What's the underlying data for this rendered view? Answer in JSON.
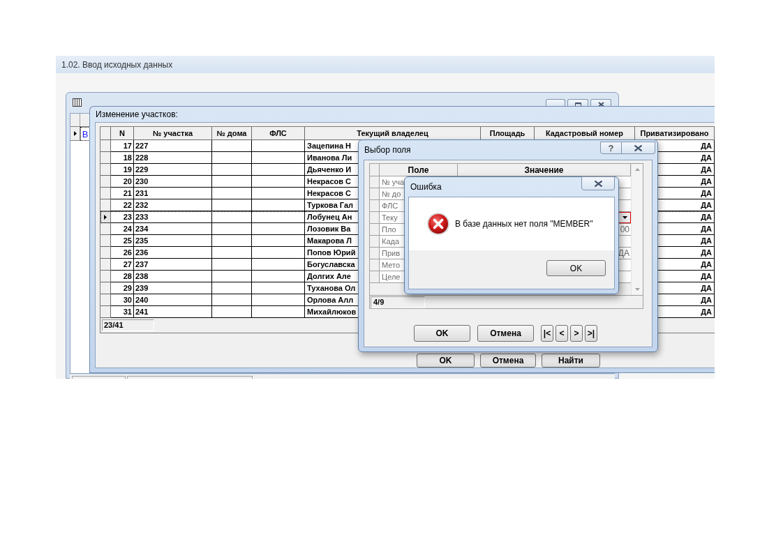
{
  "app": {
    "title": "1.02. Ввод исходных данных"
  },
  "errors_window": {
    "row": {
      "selected": true,
      "cell": "В"
    }
  },
  "parcels_window": {
    "title": "Изменение участков:",
    "columns": [
      "N",
      "№ участка",
      "№ дома",
      "ФЛС",
      "Текущий владелец",
      "Площадь",
      "Кадастровый номер",
      "Приватизировано"
    ],
    "rows": [
      {
        "n": "17",
        "number": "227",
        "owner": "Зацепина Н",
        "privatized": "ДА",
        "selected": false
      },
      {
        "n": "18",
        "number": "228",
        "owner": "Иванова Ли",
        "privatized": "ДА",
        "selected": false
      },
      {
        "n": "19",
        "number": "229",
        "owner": "Дьяченко И",
        "privatized": "ДА",
        "selected": false
      },
      {
        "n": "20",
        "number": "230",
        "owner": "Некрасов С",
        "privatized": "ДА",
        "selected": false
      },
      {
        "n": "21",
        "number": "231",
        "owner": "Некрасов С",
        "privatized": "ДА",
        "selected": false
      },
      {
        "n": "22",
        "number": "232",
        "owner": "Туркова Гал",
        "privatized": "ДА",
        "selected": false
      },
      {
        "n": "23",
        "number": "233",
        "owner": "Лобунец Ан",
        "privatized": "ДА",
        "selected": true
      },
      {
        "n": "24",
        "number": "234",
        "owner": "Лозовик Ва",
        "privatized": "ДА",
        "selected": false
      },
      {
        "n": "25",
        "number": "235",
        "owner": "Макарова Л",
        "privatized": "ДА",
        "selected": false
      },
      {
        "n": "26",
        "number": "236",
        "owner": "Попов Юрий",
        "privatized": "ДА",
        "selected": false
      },
      {
        "n": "27",
        "number": "237",
        "owner": "Богуславска",
        "privatized": "ДА",
        "selected": false
      },
      {
        "n": "28",
        "number": "238",
        "owner": "Долгих Але",
        "privatized": "ДА",
        "selected": false
      },
      {
        "n": "29",
        "number": "239",
        "owner": "Туханова Ол",
        "privatized": "ДА",
        "selected": false
      },
      {
        "n": "30",
        "number": "240",
        "owner": "Орлова Алл",
        "privatized": "ДА",
        "selected": false
      },
      {
        "n": "31",
        "number": "241",
        "owner": "Михайлюков",
        "privatized": "ДА",
        "selected": false
      }
    ],
    "position": "23/41",
    "buttons": [
      "OK",
      "Отмена",
      "Найти"
    ]
  },
  "field_dialog": {
    "title": "Выбор поля",
    "help_button": "?",
    "columns": [
      "Поле",
      "Значение"
    ],
    "rows": [
      {
        "kind": "text",
        "field": "№ уча"
      },
      {
        "kind": "text",
        "field": "№ до"
      },
      {
        "kind": "text",
        "field": "ФЛС"
      },
      {
        "kind": "dropdown",
        "field": "Теку"
      },
      {
        "kind": "text",
        "field": "Пло",
        "value": "00"
      },
      {
        "kind": "text",
        "field": "Када"
      },
      {
        "kind": "text",
        "field": "Прив",
        "value": "ДА"
      },
      {
        "kind": "text",
        "field": "Мето"
      },
      {
        "kind": "text",
        "field": "Целе"
      }
    ],
    "position": "4/9",
    "buttons": [
      "OK",
      "Отмена"
    ],
    "nav_buttons": [
      "|<",
      "<",
      ">",
      ">|"
    ]
  },
  "error_dialog": {
    "title": "Ошибка",
    "message": "В базе данных нет поля \"MEMBER\"",
    "button": "OK"
  }
}
